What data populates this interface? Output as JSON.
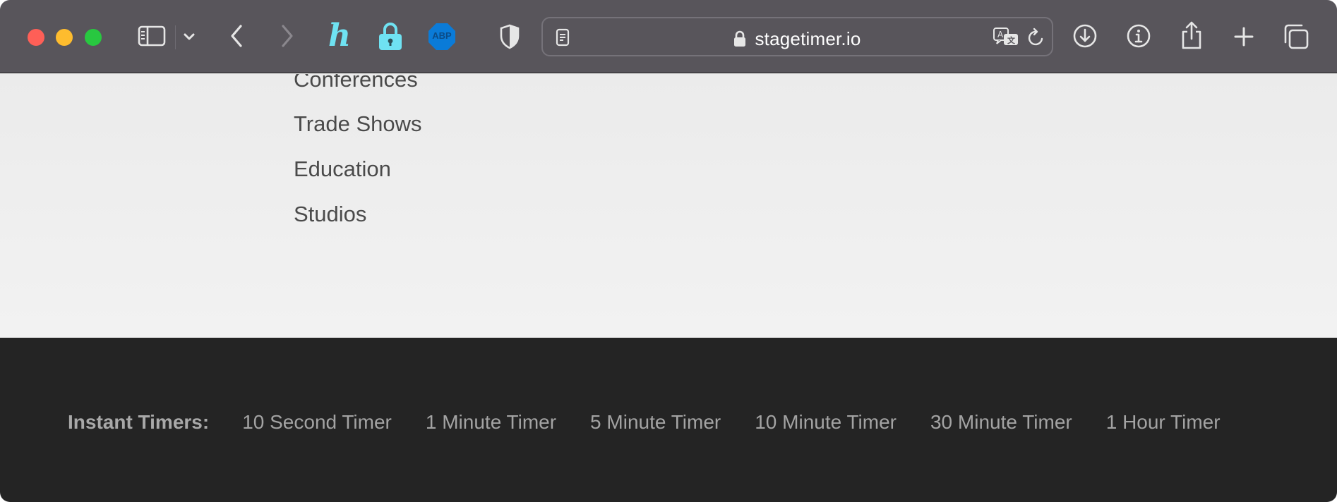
{
  "browser": {
    "url": "stagetimer.io",
    "icons": [
      "sidebar-icon",
      "chevron-down-icon",
      "back-icon",
      "forward-icon",
      "honey-extension-icon",
      "password-lock-extension-icon",
      "adblock-plus-icon",
      "privacy-shield-icon",
      "reader-mode-icon",
      "lock-icon",
      "translate-icon",
      "reload-icon",
      "downloads-icon",
      "info-icon",
      "share-icon",
      "new-tab-icon",
      "tab-overview-icon"
    ],
    "extensions": {
      "honey_letter": "h",
      "adblock_label": "ABP"
    }
  },
  "content": {
    "menu_items": [
      "Conferences",
      "Trade Shows",
      "Education",
      "Studios"
    ]
  },
  "footer": {
    "label": "Instant Timers:",
    "links": [
      "10 Second Timer",
      "1 Minute Timer",
      "5 Minute Timer",
      "10 Minute Timer",
      "30 Minute Timer",
      "1 Hour Timer"
    ]
  },
  "colors": {
    "toolbar": "#58555b",
    "footer_bg": "#242424",
    "content_bg": "#efefef",
    "traffic_red": "#fe5f57",
    "traffic_yellow": "#febc2e",
    "traffic_green": "#28c840",
    "adblock_blue": "#0a7bd8",
    "extension_cyan": "#6fe2f2"
  }
}
